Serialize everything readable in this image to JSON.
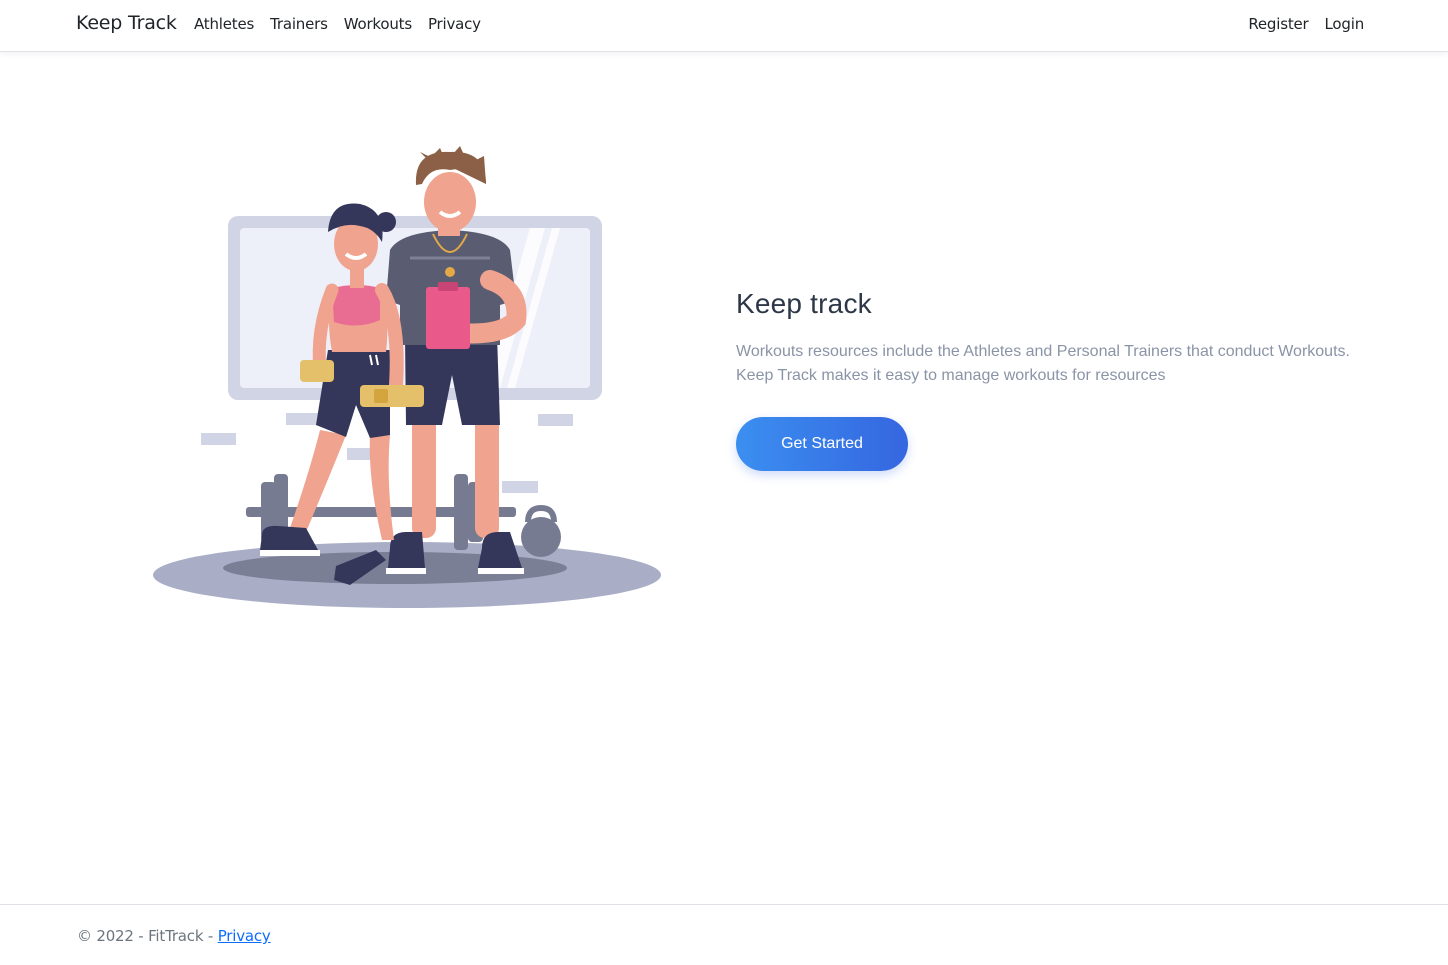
{
  "navbar": {
    "brand": "Keep Track",
    "left_links": [
      "Athletes",
      "Trainers",
      "Workouts",
      "Privacy"
    ],
    "right_links": [
      "Register",
      "Login"
    ]
  },
  "hero": {
    "title": "Keep track",
    "description_line1": "Workouts resources include the Athletes and Personal Trainers that conduct Workouts.",
    "description_line2": "Keep Track makes it easy to manage workouts for resources",
    "cta_label": "Get Started",
    "illustration": "fitness-trainer-and-athlete-illustration"
  },
  "footer": {
    "copyright": "© 2022 - FitTrack - ",
    "privacy_link": "Privacy"
  },
  "colors": {
    "cta_start": "#3b8ff0",
    "cta_end": "#3566e0",
    "link": "#0d6efd",
    "description": "#8a94a6"
  }
}
